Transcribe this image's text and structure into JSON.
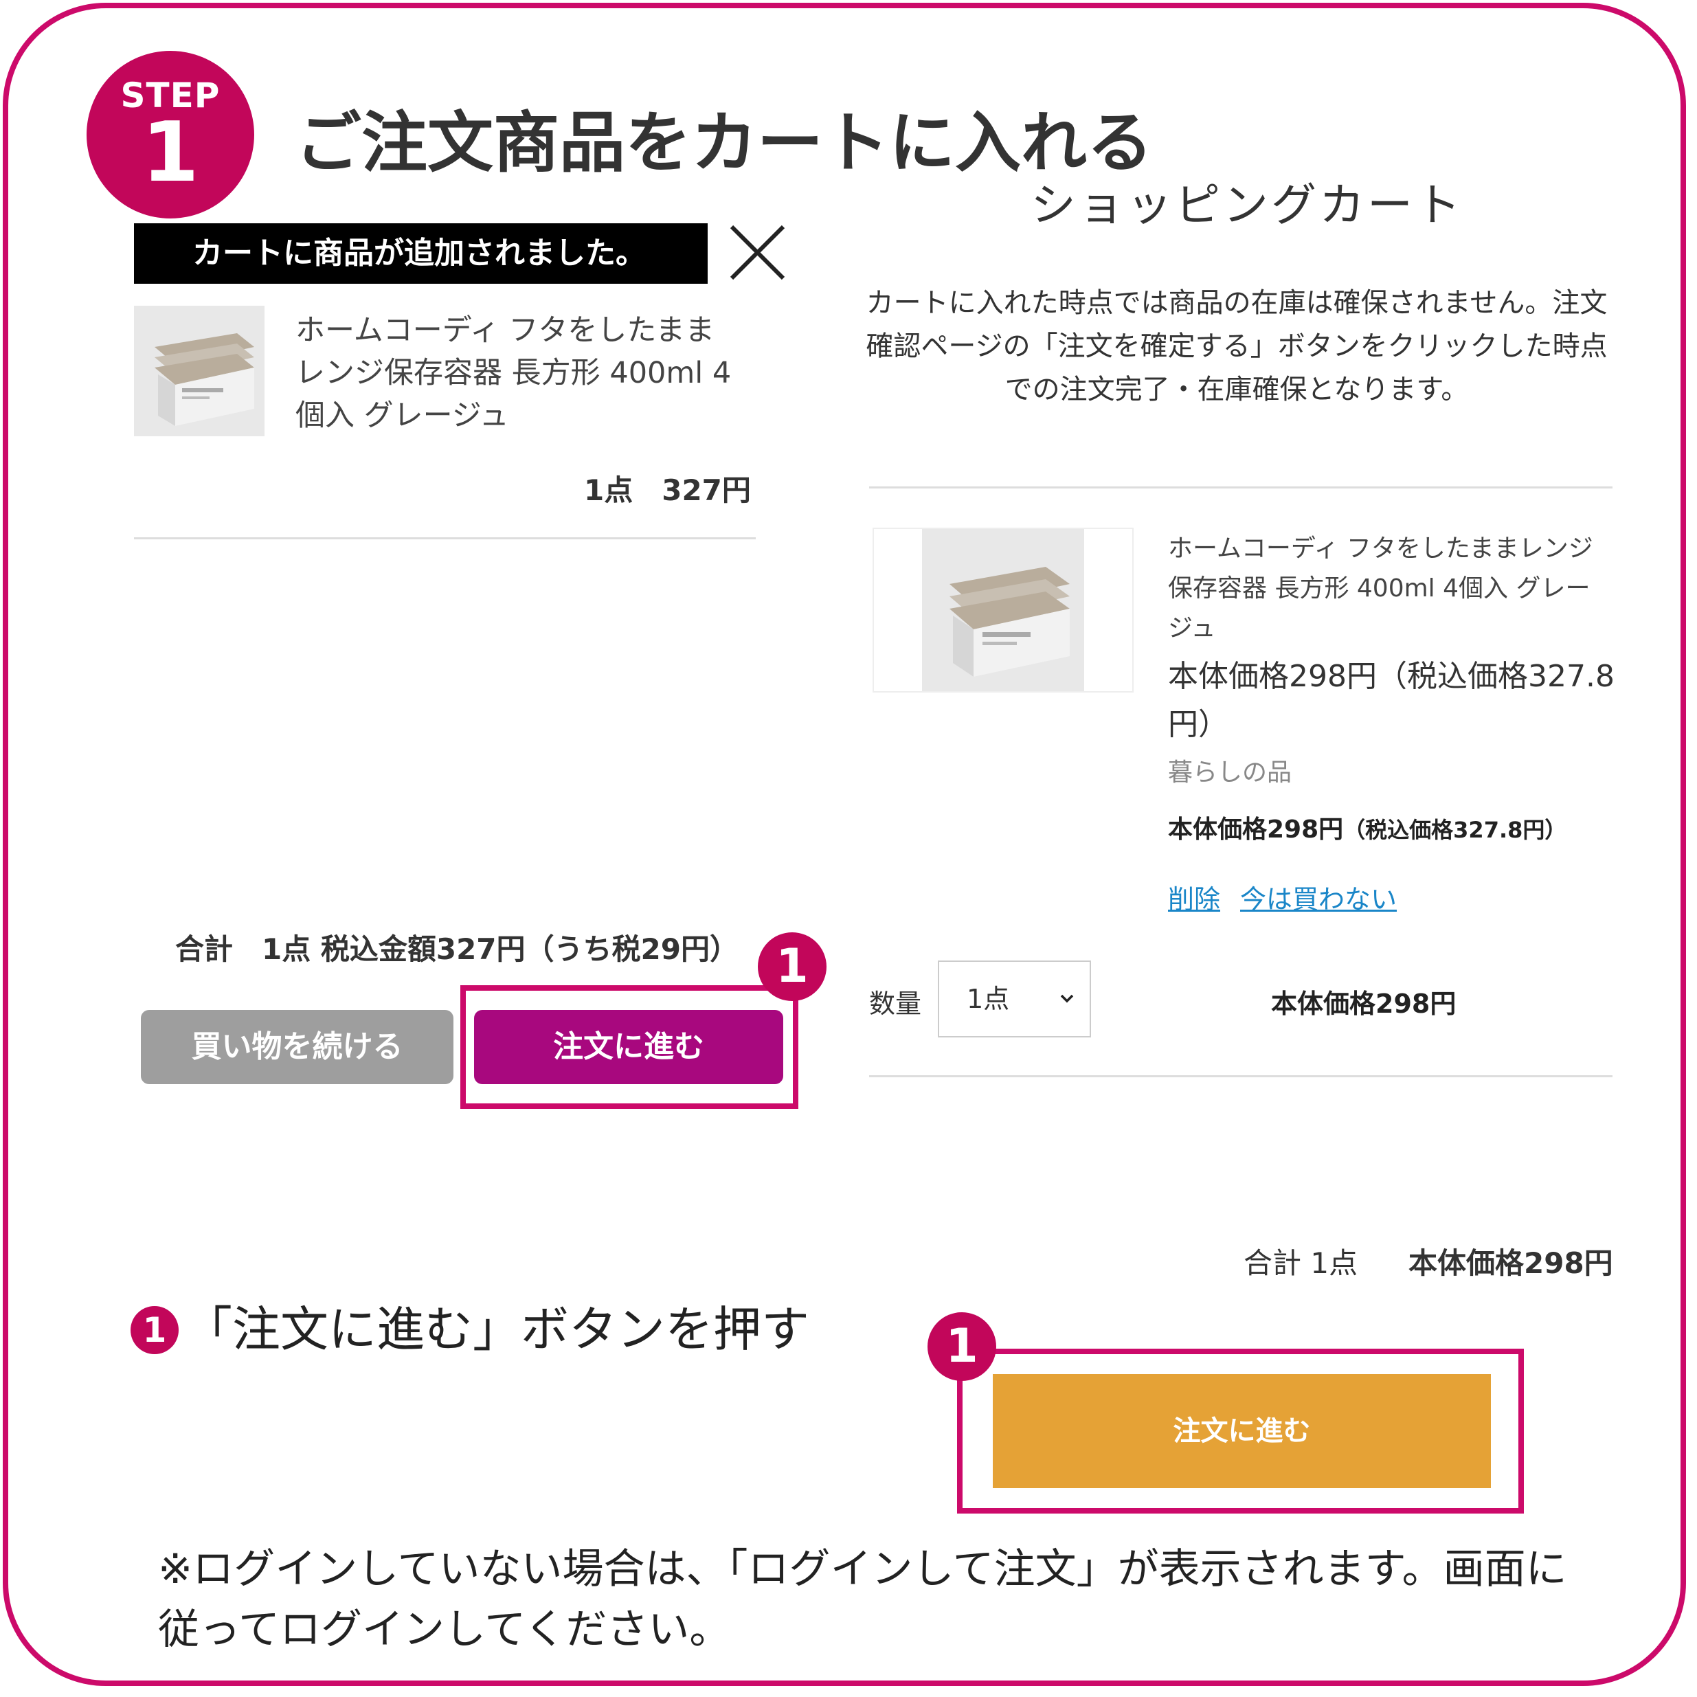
{
  "step": {
    "badge_word": "STEP",
    "badge_number": "1",
    "title": "ご注文商品をカートに入れる"
  },
  "left_panel": {
    "toast": "カートに商品が追加されました。",
    "product_name": "ホームコーディ フタをしたままレンジ保存容器 長方形 400ml 4個入 グレージュ",
    "quantity_price": "1点　327円",
    "total": "合計　1点 税込金額327円（うち税29円）",
    "continue_button": "買い物を続ける",
    "proceed_button": "注文に進む",
    "marker": "1"
  },
  "instruction": {
    "marker": "1",
    "text": "「注文に進む」ボタンを押す"
  },
  "cart": {
    "title": "ショッピングカート",
    "notice": "カートに入れた時点では商品の在庫は確保されません。注文確認ページの「注文を確定する」ボタンをクリックした時点での注文完了・在庫確保となります。",
    "item": {
      "name": "ホームコーディ フタをしたままレンジ保存容器 長方形 400ml 4個入 グレージュ",
      "price_text": "本体価格298円（税込価格327.8円）",
      "category": "暮らしの品",
      "price_small_main": "本体価格298円",
      "price_small_tax": "（税込価格327.8円）",
      "delete_link": "削除",
      "later_link": "今は買わない",
      "quantity_label": "数量",
      "quantity_value": "1点",
      "line_price": "本体価格298円"
    },
    "sum_label": "合計 1点",
    "sum_price": "本体価格298円",
    "order_button": "注文に進む",
    "marker": "1"
  },
  "note": "※ログインしていない場合は、「ログインして注文」が表示されます。画面に従ってログインしてください。",
  "colors": {
    "accent": "#cc0a6a",
    "proceed_button": "#a8087e",
    "continue_button": "#9e9e9e",
    "order_button": "#e5a236",
    "link": "#1a86c8"
  },
  "icons": [
    "close-icon",
    "chevron-down-icon"
  ]
}
